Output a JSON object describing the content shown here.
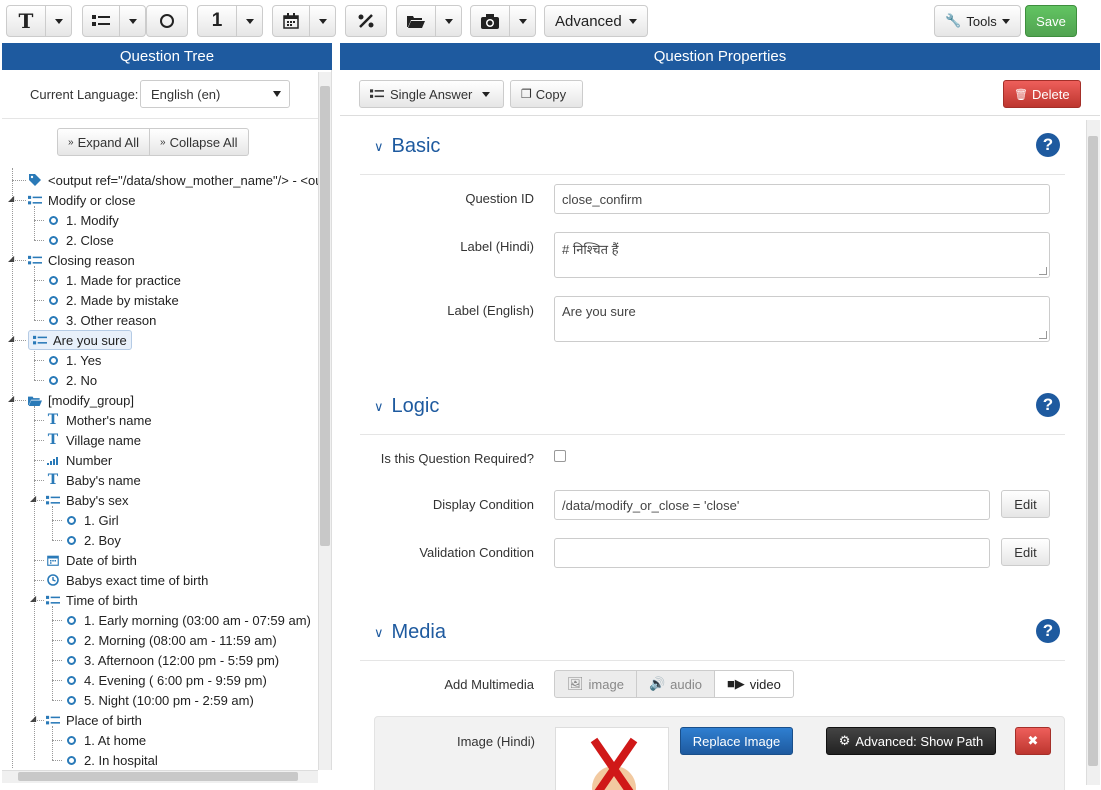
{
  "toolbar": {
    "advanced_label": "Advanced",
    "tools_label": "Tools",
    "save_label": "Save"
  },
  "left": {
    "header": "Question Tree",
    "language_label": "Current Language:",
    "language_value": "English (en)",
    "expand_all": "Expand All",
    "collapse_all": "Collapse All"
  },
  "tree": [
    {
      "label": "<output ref=\"/data/show_mother_name\"/> - <ou",
      "icon": "tag",
      "level": 0
    },
    {
      "label": "Modify or close",
      "icon": "list",
      "level": 0
    },
    {
      "label": "1. Modify",
      "icon": "radio",
      "level": 1
    },
    {
      "label": "2. Close",
      "icon": "radio",
      "level": 1
    },
    {
      "label": "Closing reason",
      "icon": "list",
      "level": 0
    },
    {
      "label": "1. Made for practice",
      "icon": "radio",
      "level": 1
    },
    {
      "label": "2. Made by mistake",
      "icon": "radio",
      "level": 1
    },
    {
      "label": "3. Other reason",
      "icon": "radio",
      "level": 1
    },
    {
      "label": "Are you sure",
      "icon": "list",
      "level": 0,
      "selected": true
    },
    {
      "label": "1. Yes",
      "icon": "radio",
      "level": 1
    },
    {
      "label": "2. No",
      "icon": "radio",
      "level": 1
    },
    {
      "label": "[modify_group]",
      "icon": "folder",
      "level": 0
    },
    {
      "label": "Mother's name",
      "icon": "text",
      "level": 1
    },
    {
      "label": "Village name",
      "icon": "text",
      "level": 1
    },
    {
      "label": "Number",
      "icon": "signal",
      "level": 1
    },
    {
      "label": "Baby's name",
      "icon": "text",
      "level": 1
    },
    {
      "label": "Baby's sex",
      "icon": "list",
      "level": 1
    },
    {
      "label": "1. Girl",
      "icon": "radio",
      "level": 2
    },
    {
      "label": "2. Boy",
      "icon": "radio",
      "level": 2
    },
    {
      "label": "Date of birth",
      "icon": "calendar",
      "level": 1
    },
    {
      "label": "Babys exact time of birth",
      "icon": "clock",
      "level": 1
    },
    {
      "label": "Time of birth",
      "icon": "list",
      "level": 1
    },
    {
      "label": "1. Early morning (03:00 am - 07:59 am)",
      "icon": "radio",
      "level": 2
    },
    {
      "label": "2. Morning (08:00 am - 11:59 am)",
      "icon": "radio",
      "level": 2
    },
    {
      "label": "3. Afternoon (12:00 pm - 5:59 pm)",
      "icon": "radio",
      "level": 2
    },
    {
      "label": "4. Evening ( 6:00 pm - 9:59 pm)",
      "icon": "radio",
      "level": 2
    },
    {
      "label": "5. Night (10:00 pm - 2:59 am)",
      "icon": "radio",
      "level": 2
    },
    {
      "label": "Place of birth",
      "icon": "list",
      "level": 1
    },
    {
      "label": "1. At home",
      "icon": "radio",
      "level": 2
    },
    {
      "label": "2. In hospital",
      "icon": "radio",
      "level": 2
    }
  ],
  "right": {
    "header": "Question Properties",
    "type_label": "Single Answer",
    "copy_label": "Copy",
    "delete_label": "Delete",
    "basic": {
      "title": "Basic",
      "question_id_label": "Question ID",
      "question_id_value": "close_confirm",
      "label_hindi_label": "Label (Hindi)",
      "label_hindi_value": "# निश्चित हैं",
      "label_english_label": "Label (English)",
      "label_english_value": "Are you sure"
    },
    "logic": {
      "title": "Logic",
      "required_label": "Is this Question Required?",
      "display_label": "Display Condition",
      "display_value": "/data/modify_or_close = 'close'",
      "validation_label": "Validation Condition",
      "validation_value": "",
      "edit_label": "Edit"
    },
    "media": {
      "title": "Media",
      "add_label": "Add Multimedia",
      "image_btn": "image",
      "audio_btn": "audio",
      "video_btn": "video",
      "image_hindi_label": "Image (Hindi)",
      "replace_label": "Replace Image",
      "advanced_path_label": "Advanced: Show Path"
    }
  }
}
